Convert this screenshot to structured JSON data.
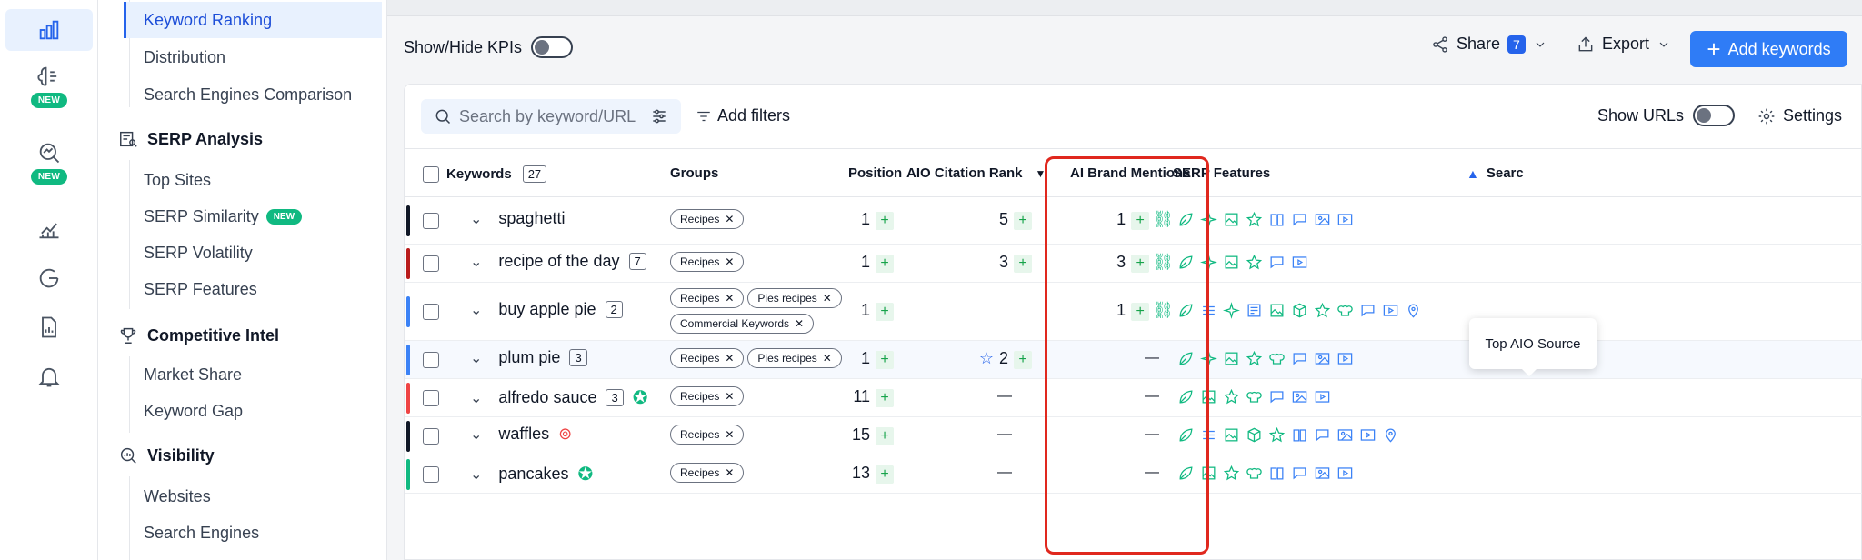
{
  "rail": {
    "new_label": "NEW"
  },
  "nav": {
    "rank_items": [
      "Keyword Ranking",
      "Distribution",
      "Search Engines Comparison"
    ],
    "serp_title": "SERP Analysis",
    "serp_items": [
      "Top Sites",
      "SERP Similarity",
      "SERP Volatility",
      "SERP Features"
    ],
    "serp_new": "NEW",
    "comp_title": "Competitive Intel",
    "comp_items": [
      "Market Share",
      "Keyword Gap"
    ],
    "vis_title": "Visibility",
    "vis_items": [
      "Websites",
      "Search Engines"
    ]
  },
  "toolbar": {
    "kpi_label": "Show/Hide KPIs",
    "share_label": "Share",
    "share_count": "7",
    "export_label": "Export",
    "add_label": "Add keywords"
  },
  "filters": {
    "search_placeholder": "Search by keyword/URL",
    "add_filters": "Add filters",
    "show_urls": "Show URLs",
    "settings": "Settings"
  },
  "table": {
    "columns": {
      "keywords": "Keywords",
      "keywords_count": "27",
      "groups": "Groups",
      "position": "Position",
      "aio": "AIO Citation Rank",
      "brand": "AI Brand Mentions",
      "serp": "SERP Features",
      "search": "Searc"
    },
    "rows": [
      {
        "keyword": "spaghetti",
        "count": "",
        "groups": [
          "Recipes"
        ],
        "groups2": [],
        "position": "1",
        "aio": "5",
        "brand": "1"
      },
      {
        "keyword": "recipe of the day",
        "count": "7",
        "groups": [
          "Recipes"
        ],
        "groups2": [],
        "position": "1",
        "aio": "3",
        "brand": "3"
      },
      {
        "keyword": "buy apple pie",
        "count": "2",
        "groups": [
          "Recipes",
          "Pies recipes"
        ],
        "groups2": [
          "Commercial Keywords"
        ],
        "position": "1",
        "aio": "",
        "brand": "1"
      },
      {
        "keyword": "plum pie",
        "count": "3",
        "groups": [
          "Recipes",
          "Pies recipes"
        ],
        "groups2": [],
        "position": "1",
        "aio": "2",
        "brand": "—"
      },
      {
        "keyword": "alfredo sauce",
        "count": "3",
        "groups": [
          "Recipes"
        ],
        "groups2": [],
        "position": "11",
        "aio": "—",
        "brand": "—"
      },
      {
        "keyword": "waffles",
        "count": "",
        "groups": [
          "Recipes"
        ],
        "groups2": [],
        "position": "15",
        "aio": "—",
        "brand": "—"
      },
      {
        "keyword": "pancakes",
        "count": "",
        "groups": [
          "Recipes"
        ],
        "groups2": [],
        "position": "13",
        "aio": "—",
        "brand": "—"
      }
    ],
    "feature_counts": {
      "r2a": "5",
      "r2b": "2",
      "r2c": "3",
      "r4a": "2",
      "r5a": "3",
      "r5b": "3"
    }
  },
  "tooltip": {
    "text": "Top AIO Source"
  },
  "colors": {
    "accent": "#2f7cf6",
    "highlight": "#e0281e",
    "green": "#10b981"
  }
}
